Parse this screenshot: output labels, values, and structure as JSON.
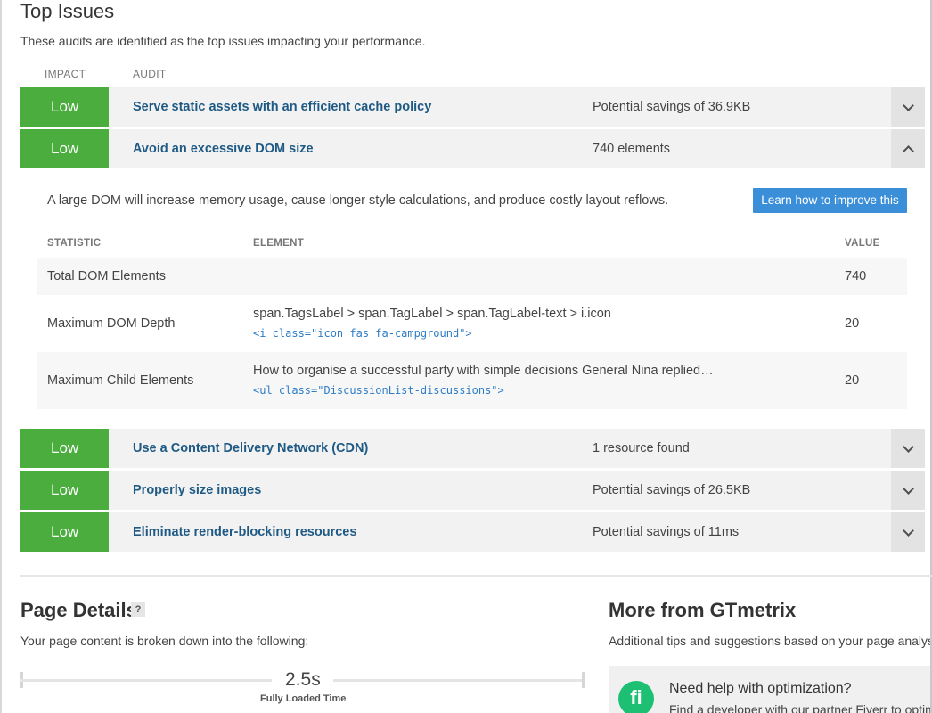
{
  "top_issues": {
    "title": "Top Issues",
    "description": "These audits are identified as the top issues impacting your performance.",
    "col_impact": "IMPACT",
    "col_audit": "AUDIT",
    "issues": [
      {
        "impact": "Low",
        "audit": "Serve static assets with an efficient cache policy",
        "metric": "Potential savings of 36.9KB",
        "expanded": false
      },
      {
        "impact": "Low",
        "audit": "Avoid an excessive DOM size",
        "metric": "740 elements",
        "expanded": true
      },
      {
        "impact": "Low",
        "audit": "Use a Content Delivery Network (CDN)",
        "metric": "1 resource found",
        "expanded": false
      },
      {
        "impact": "Low",
        "audit": "Properly size images",
        "metric": "Potential savings of 26.5KB",
        "expanded": false
      },
      {
        "impact": "Low",
        "audit": "Eliminate render-blocking resources",
        "metric": "Potential savings of 11ms",
        "expanded": false
      }
    ],
    "dom_detail": {
      "description": "A large DOM will increase memory usage, cause longer style calculations, and produce costly layout reflows.",
      "learn_button": "Learn how to improve this",
      "headers": {
        "statistic": "STATISTIC",
        "element": "ELEMENT",
        "value": "VALUE"
      },
      "rows": [
        {
          "statistic": "Total DOM Elements",
          "element": "",
          "code": "",
          "value": "740"
        },
        {
          "statistic": "Maximum DOM Depth",
          "element": "span.TagsLabel > span.TagLabel > span.TagLabel-text > i.icon",
          "code": "<i class=\"icon fas fa-campground\">",
          "value": "20"
        },
        {
          "statistic": "Maximum Child Elements",
          "element": "How to organise a successful party with simple decisions General Nina replied…",
          "code": "<ul class=\"DiscussionList-discussions\">",
          "value": "20"
        }
      ]
    }
  },
  "page_details": {
    "title": "Page Details",
    "help": "?",
    "description": "Your page content is broken down into the following:",
    "fully_loaded_value": "2.5s",
    "fully_loaded_label": "Fully Loaded Time"
  },
  "more_from": {
    "title": "More from GTmetrix",
    "description": "Additional tips and suggestions based on your page analys",
    "help_title": "Need help with optimization?",
    "help_sub": "Find a developer with our partner Fiverr to optim",
    "fiverr_glyph": "fi"
  },
  "colors": {
    "impact_low": "#4aad3e",
    "audit_link": "#1f5a85",
    "button": "#3b8fd9",
    "code": "#2f7dc6"
  }
}
